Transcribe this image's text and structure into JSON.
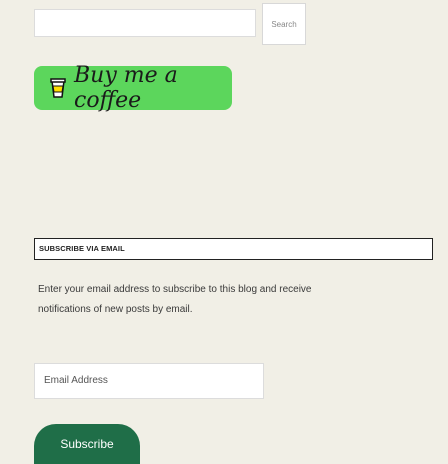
{
  "search": {
    "button_label": "Search",
    "value": ""
  },
  "bmc": {
    "label": "Buy me a coffee"
  },
  "subscribe": {
    "header": "SUBSCRIBE VIA EMAIL",
    "description": "Enter your email address to subscribe to this blog and receive notifications of new posts by email.",
    "email_placeholder": "Email Address",
    "button_label": "Subscribe"
  }
}
